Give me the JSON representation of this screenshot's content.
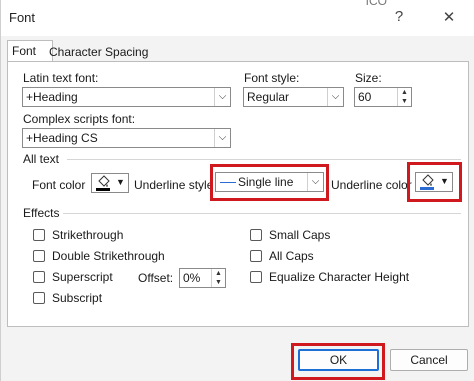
{
  "window": {
    "title": "Font",
    "help_icon": "?",
    "close_icon": "✕",
    "background_fragment": "ICO"
  },
  "tabs": [
    {
      "label": "Font",
      "active": true
    },
    {
      "label": "Character Spacing",
      "active": false
    }
  ],
  "latin_font": {
    "label": "Latin text font:",
    "value": "+Heading"
  },
  "font_style": {
    "label": "Font style:",
    "value": "Regular"
  },
  "size": {
    "label": "Size:",
    "value": "60"
  },
  "complex_font": {
    "label": "Complex scripts font:",
    "value": "+Heading CS"
  },
  "all_text": {
    "section_label": "All text",
    "font_color_label": "Font color",
    "underline_style_label": "Underline style",
    "underline_style_value": "Single line",
    "underline_color_label": "Underline color"
  },
  "effects": {
    "section_label": "Effects",
    "strikethrough": "Strikethrough",
    "double_strikethrough": "Double Strikethrough",
    "superscript": "Superscript",
    "subscript": "Subscript",
    "offset_label": "Offset:",
    "offset_value": "0%",
    "small_caps": "Small Caps",
    "all_caps": "All Caps",
    "equalize": "Equalize Character Height"
  },
  "buttons": {
    "ok": "OK",
    "cancel": "Cancel"
  },
  "colors": {
    "highlight_box": "#d0191f",
    "primary_border": "#1c6fd6",
    "underline_swatch": "#2b6cd4",
    "font_swatch": "#000000"
  }
}
